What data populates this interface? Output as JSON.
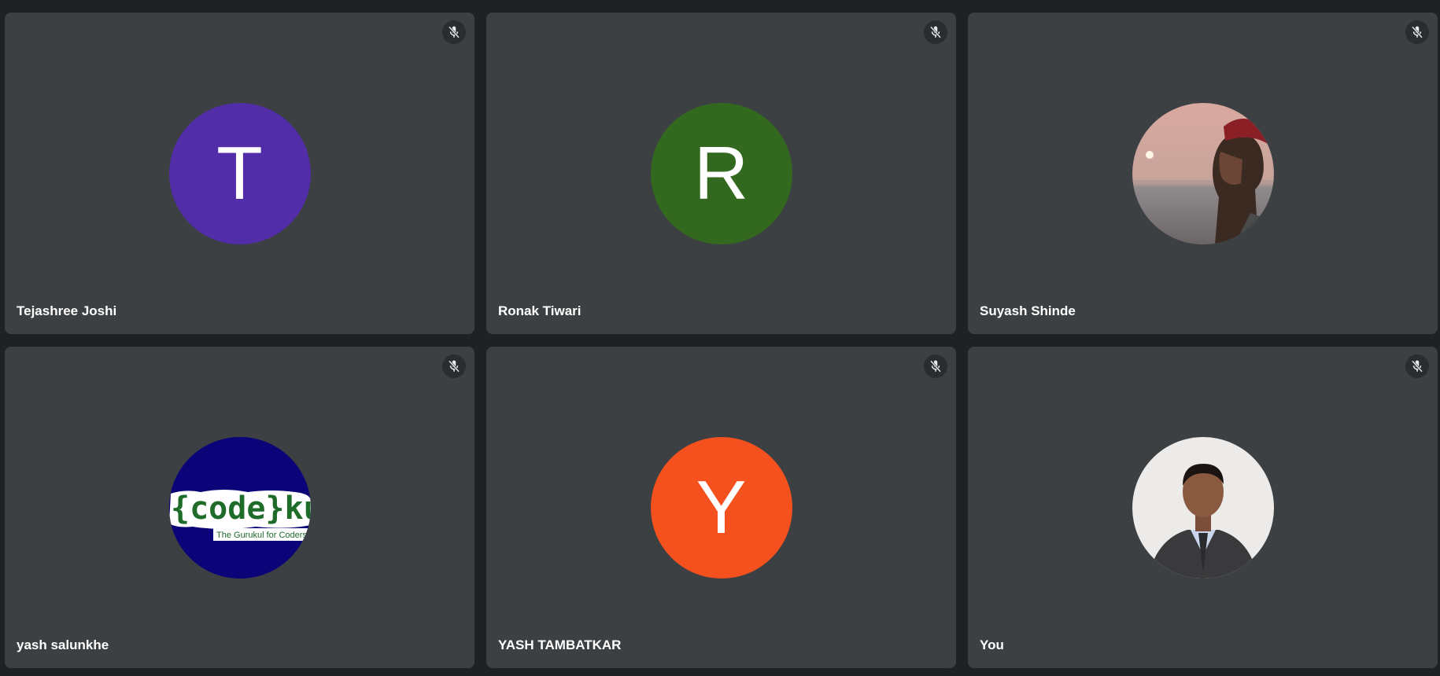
{
  "meeting": {
    "tiles": [
      {
        "name": "Tejashree Joshi",
        "initial": "T",
        "avatar_type": "letter",
        "avatar_color": "#512da8",
        "mic_icon": "mic-off-icon",
        "muted": true
      },
      {
        "name": "Ronak Tiwari",
        "initial": "R",
        "avatar_type": "letter",
        "avatar_color": "#33691e",
        "mic_icon": "mic-off-icon",
        "muted": true
      },
      {
        "name": "Suyash Shinde",
        "avatar_type": "photo",
        "avatar_desc": "profile-photo-sunset-beach",
        "mic_icon": "mic-off-icon",
        "muted": true
      },
      {
        "name": "yash salunkhe",
        "avatar_type": "logo",
        "logo_text": "{code}kul;",
        "logo_tagline": "The Gurukul for Coders",
        "avatar_color": "#0b0378",
        "mic_icon": "mic-off-icon",
        "muted": true
      },
      {
        "name": "YASH TAMBATKAR",
        "initial": "Y",
        "avatar_type": "letter",
        "avatar_color": "#f4511e",
        "mic_icon": "mic-off-icon",
        "muted": true
      },
      {
        "name": "You",
        "avatar_type": "photo",
        "avatar_desc": "profile-photo-suit",
        "mic_icon": "mic-off-icon",
        "muted": true
      }
    ]
  },
  "colors": {
    "background": "#202124",
    "tile": "#3c4043",
    "mic_badge": "#2a2c2f",
    "text": "#ffffff"
  }
}
